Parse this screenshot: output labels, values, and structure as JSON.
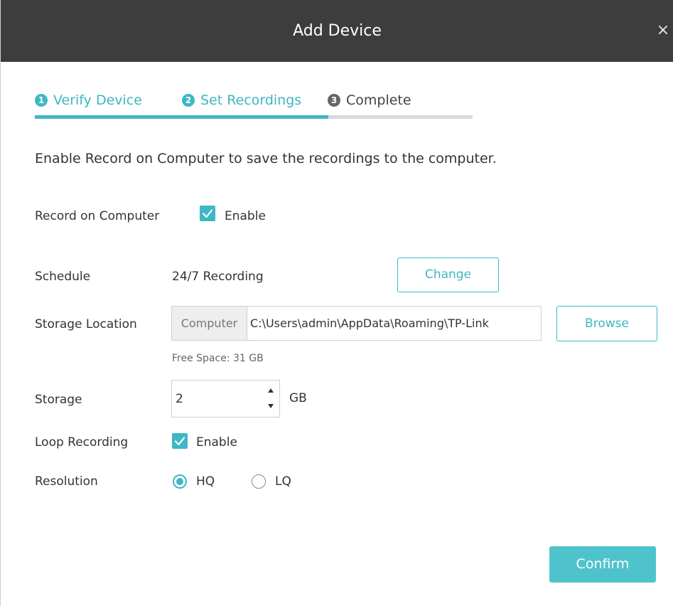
{
  "dialog": {
    "title": "Add Device",
    "close_glyph": "×"
  },
  "steps": [
    {
      "number": "1",
      "label": "Verify Device",
      "state": "active"
    },
    {
      "number": "2",
      "label": "Set Recordings",
      "state": "active"
    },
    {
      "number": "3",
      "label": "Complete",
      "state": "inactive"
    }
  ],
  "step_progress": 0.67,
  "description": "Enable Record on Computer to save the recordings to the computer.",
  "record_on_computer": {
    "label": "Record on Computer",
    "checkbox_label": "Enable",
    "checked": true
  },
  "schedule": {
    "label": "Schedule",
    "value": "24/7 Recording",
    "button": "Change"
  },
  "storage_location": {
    "label": "Storage Location",
    "prefix": "Computer",
    "path": "C:\\Users\\admin\\AppData\\Roaming\\TP-Link",
    "button": "Browse",
    "free_space": "Free Space: 31 GB"
  },
  "storage": {
    "label": "Storage",
    "value": "2",
    "unit": "GB"
  },
  "loop_recording": {
    "label": "Loop Recording",
    "checkbox_label": "Enable",
    "checked": true
  },
  "resolution": {
    "label": "Resolution",
    "options": [
      {
        "label": "HQ",
        "selected": true
      },
      {
        "label": "LQ",
        "selected": false
      }
    ]
  },
  "confirm_button": "Confirm",
  "colors": {
    "accent": "#3fb7c4",
    "titlebar": "#3d3d3d",
    "primary_button": "#4fc3cc"
  },
  "icons": {
    "close": "close-icon",
    "checkbox": "checkmark-icon",
    "spinner_up": "triangle-up-icon",
    "spinner_down": "triangle-down-icon"
  }
}
